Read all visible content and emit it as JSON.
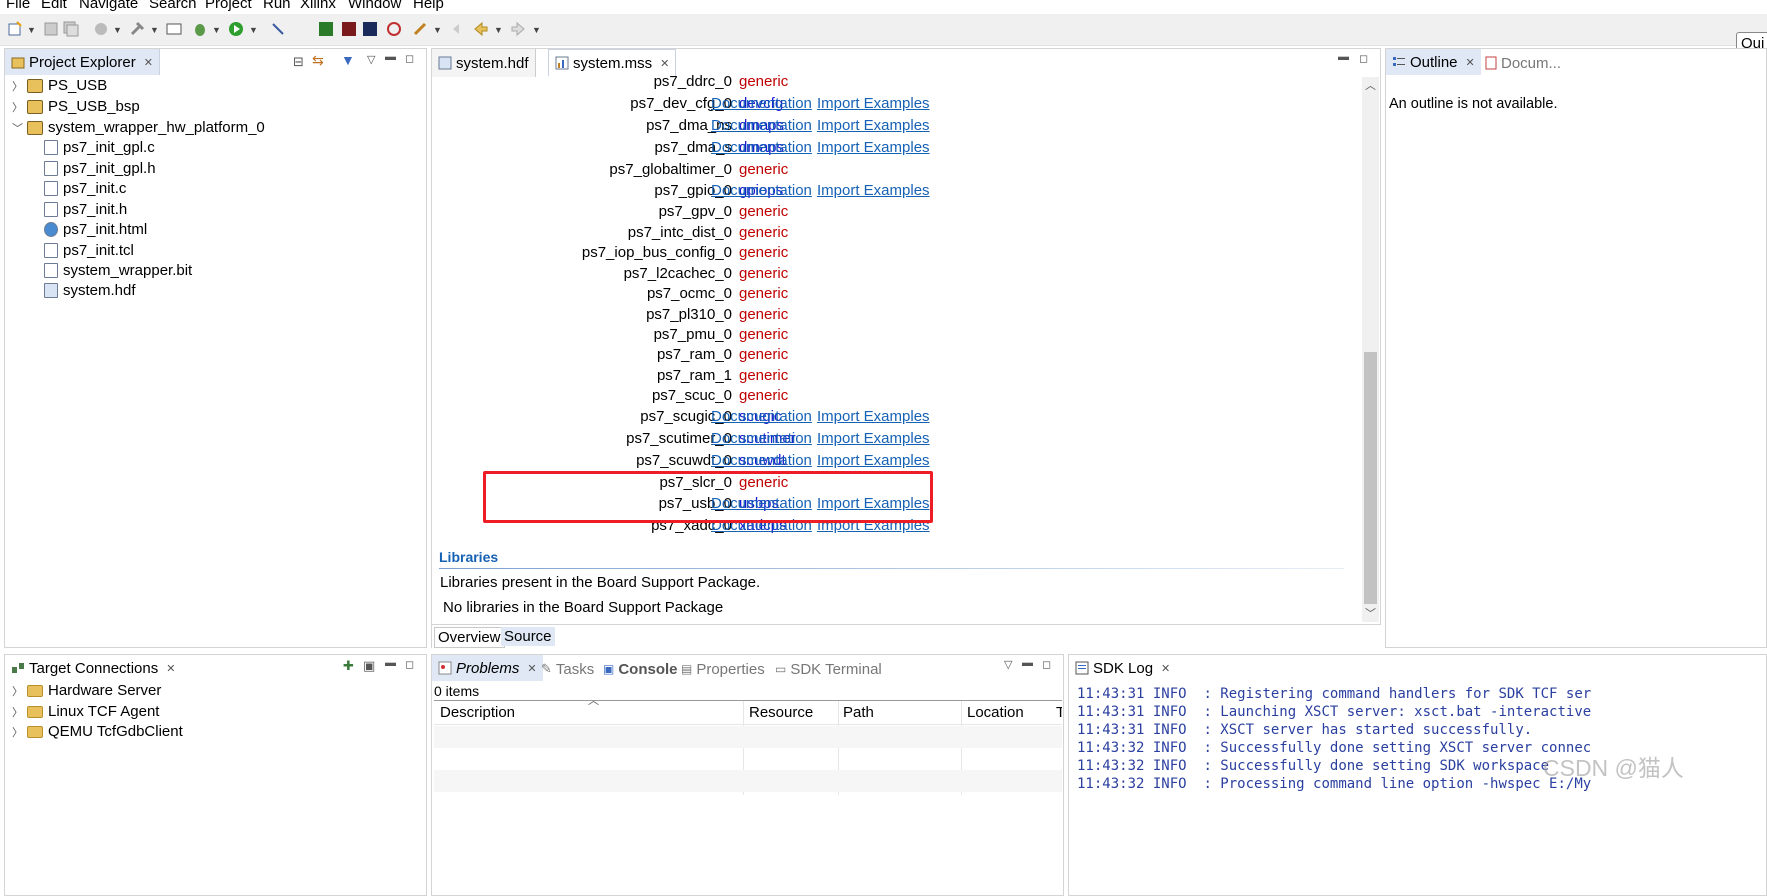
{
  "menu": [
    "File",
    "Edit",
    "Navigate",
    "Search",
    "Project",
    "Run",
    "Xilinx",
    "Window",
    "Help"
  ],
  "quick_access": {
    "value": "Qui"
  },
  "project_explorer": {
    "title": "Project Explorer",
    "items": [
      {
        "label": "PS_USB",
        "level": 0,
        "expanded": false
      },
      {
        "label": "PS_USB_bsp",
        "level": 0,
        "expanded": false
      },
      {
        "label": "system_wrapper_hw_platform_0",
        "level": 0,
        "expanded": true
      },
      {
        "label": "ps7_init_gpl.c",
        "level": 1
      },
      {
        "label": "ps7_init_gpl.h",
        "level": 1
      },
      {
        "label": "ps7_init.c",
        "level": 1
      },
      {
        "label": "ps7_init.h",
        "level": 1
      },
      {
        "label": "ps7_init.html",
        "level": 1
      },
      {
        "label": "ps7_init.tcl",
        "level": 1
      },
      {
        "label": "system_wrapper.bit",
        "level": 1
      },
      {
        "label": "system.hdf",
        "level": 1
      }
    ]
  },
  "editor": {
    "tabs": [
      {
        "label": "system.hdf",
        "active": false
      },
      {
        "label": "system.mss",
        "active": true
      }
    ],
    "doc_link": "Documentation",
    "examples_link": "Import Examples",
    "drivers": [
      {
        "name": "ps7_ddrc_0",
        "driver": "generic",
        "links": false
      },
      {
        "name": "ps7_dev_cfg_0",
        "driver": "devcfg",
        "links": true
      },
      {
        "name": "ps7_dma_ns",
        "driver": "dmaps",
        "links": true
      },
      {
        "name": "ps7_dma_s",
        "driver": "dmaps",
        "links": true
      },
      {
        "name": "ps7_globaltimer_0",
        "driver": "generic",
        "links": false
      },
      {
        "name": "ps7_gpio_0",
        "driver": "gpiops",
        "links": true
      },
      {
        "name": "ps7_gpv_0",
        "driver": "generic",
        "links": false
      },
      {
        "name": "ps7_intc_dist_0",
        "driver": "generic",
        "links": false
      },
      {
        "name": "ps7_iop_bus_config_0",
        "driver": "generic",
        "links": false
      },
      {
        "name": "ps7_l2cachec_0",
        "driver": "generic",
        "links": false
      },
      {
        "name": "ps7_ocmc_0",
        "driver": "generic",
        "links": false
      },
      {
        "name": "ps7_pl310_0",
        "driver": "generic",
        "links": false
      },
      {
        "name": "ps7_pmu_0",
        "driver": "generic",
        "links": false
      },
      {
        "name": "ps7_ram_0",
        "driver": "generic",
        "links": false
      },
      {
        "name": "ps7_ram_1",
        "driver": "generic",
        "links": false
      },
      {
        "name": "ps7_scuc_0",
        "driver": "generic",
        "links": false
      },
      {
        "name": "ps7_scugic_0",
        "driver": "scugic",
        "links": true
      },
      {
        "name": "ps7_scutimer_0",
        "driver": "scutimer",
        "links": true
      },
      {
        "name": "ps7_scuwdt_0",
        "driver": "scuwdt",
        "links": true
      },
      {
        "name": "ps7_slcr_0",
        "driver": "generic",
        "links": false
      },
      {
        "name": "ps7_usb_0",
        "driver": "usbps",
        "links": true
      },
      {
        "name": "ps7_xadc_0",
        "driver": "xadcps",
        "links": true
      }
    ],
    "libraries_header": "Libraries",
    "libraries_line1": "Libraries present in the Board Support Package.",
    "libraries_line2": "No libraries in the Board Support Package",
    "bottom_tabs": [
      "Overview",
      "Source"
    ]
  },
  "outline": {
    "tab1": "Outline",
    "tab2": "Docum...",
    "message": "An outline is not available."
  },
  "target_connections": {
    "title": "Target Connections",
    "items": [
      "Hardware Server",
      "Linux TCF Agent",
      "QEMU TcfGdbClient"
    ]
  },
  "problems": {
    "tabs": [
      "Problems",
      "Tasks",
      "Console",
      "Properties",
      "SDK Terminal"
    ],
    "count": "0 items",
    "columns": [
      "Description",
      "Resource",
      "Path",
      "Location",
      "T"
    ]
  },
  "sdk_log": {
    "title": "SDK Log",
    "lines": [
      {
        "time": "11:43:31",
        "level": "INFO",
        "msg": ": Registering command handlers for SDK TCF ser"
      },
      {
        "time": "11:43:31",
        "level": "INFO",
        "msg": ": Launching XSCT server: xsct.bat -interactive"
      },
      {
        "time": "11:43:31",
        "level": "INFO",
        "msg": ": XSCT server has started successfully."
      },
      {
        "time": "11:43:32",
        "level": "INFO",
        "msg": ": Successfully done setting XSCT server connec"
      },
      {
        "time": "11:43:32",
        "level": "INFO",
        "msg": ": Successfully done setting SDK workspace"
      },
      {
        "time": "11:43:32",
        "level": "INFO",
        "msg": ": Processing command line option -hwspec E:/My"
      }
    ]
  },
  "watermark": "CSDN @猫人",
  "colors": {
    "generic": "#c00000",
    "driver": "#1a1ad0",
    "link": "#1561b5",
    "highlight": "#ee1c24",
    "log": "#2a3fa0"
  }
}
